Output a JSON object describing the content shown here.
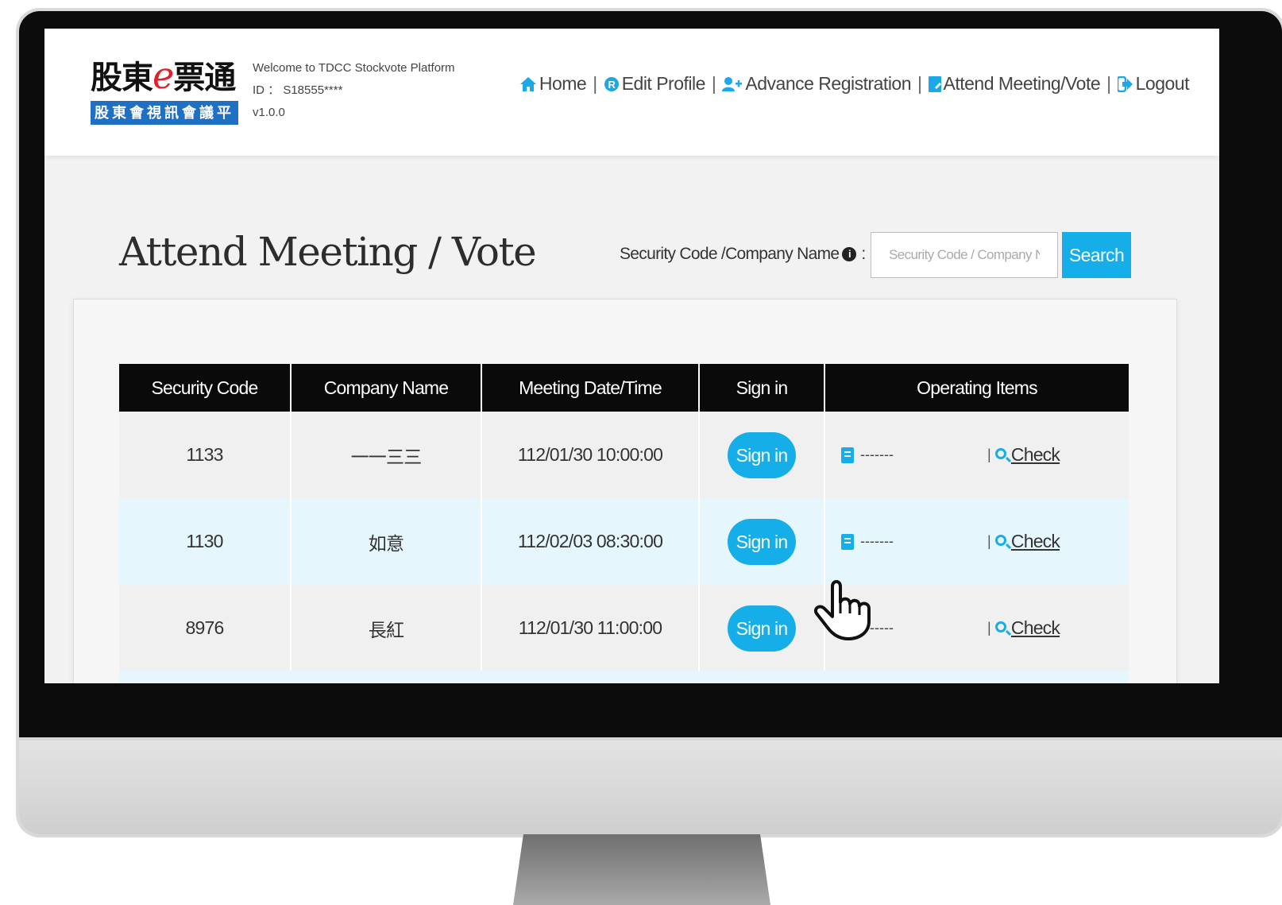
{
  "header": {
    "logo": {
      "main": "股東",
      "e": "e",
      "main2": "票通",
      "sub": "股東會視訊會議平台"
    },
    "welcome": "Welcome to TDCC Stockvote Platform",
    "id_line": "ID ： S18555****",
    "version": "v1.0.0"
  },
  "nav": {
    "home": "Home",
    "edit_profile": "Edit Profile",
    "advance_registration": "Advance Registration",
    "attend": "Attend Meeting/Vote",
    "logout": "Logout",
    "separator": "|"
  },
  "page": {
    "title": "Attend Meeting / Vote",
    "search_label": "Security Code /Company Name",
    "search_colon": ":",
    "search_placeholder": "Security Code / Company Name",
    "search_button": "Search"
  },
  "table": {
    "headers": [
      "Security Code",
      "Company Name",
      "Meeting Date/Time",
      "Sign in",
      "Operating Items"
    ],
    "rows": [
      {
        "code": "1133",
        "name": "一一三三",
        "datetime": "112/01/30 10:00:00",
        "signin": "Sign in",
        "ops": "-------",
        "check": "Check"
      },
      {
        "code": "1130",
        "name": "如意",
        "datetime": "112/02/03 08:30:00",
        "signin": "Sign in",
        "ops": "-------",
        "check": "Check"
      },
      {
        "code": "8976",
        "name": "長紅",
        "datetime": "112/01/30 11:00:00",
        "signin": "Sign in",
        "ops": "-------",
        "check": "Check"
      }
    ]
  },
  "colors": {
    "accent": "#15aee8",
    "header_bg": "#0a0a0a",
    "highlight_row": "#e5f6fd"
  }
}
